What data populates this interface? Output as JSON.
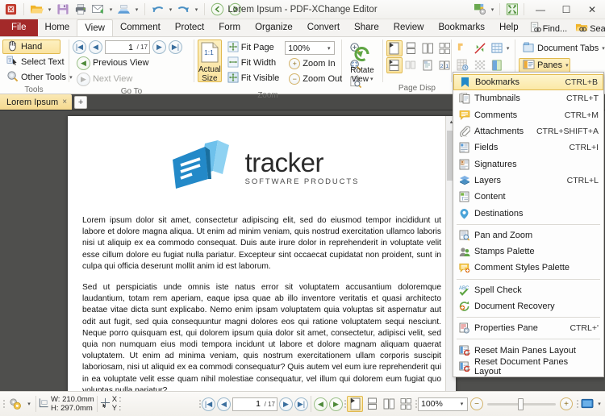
{
  "window": {
    "title": "Lorem Ipsum - PDF-XChange Editor",
    "minimize": "—",
    "maximize": "☐",
    "close": "✕"
  },
  "quick_access": {
    "items": [
      {
        "name": "app-logo-icon",
        "label": ""
      },
      {
        "name": "open-icon",
        "label": "Open"
      },
      {
        "name": "save-icon",
        "label": "Save"
      },
      {
        "name": "print-icon",
        "label": "Print"
      },
      {
        "name": "email-icon",
        "label": "Email"
      },
      {
        "name": "scan-icon",
        "label": "Scan"
      },
      {
        "name": "undo-icon",
        "label": "Undo"
      },
      {
        "name": "redo-icon",
        "label": "Redo"
      },
      {
        "name": "back-icon",
        "label": "Previous View"
      },
      {
        "name": "forward-icon",
        "label": "Next View"
      }
    ],
    "customize_icon": "customize-quick-access-icon",
    "fullscreen_icon": "fullscreen-icon"
  },
  "menubar": {
    "file": "File",
    "tabs": [
      {
        "label": "Home",
        "active": false
      },
      {
        "label": "View",
        "active": true
      },
      {
        "label": "Comment",
        "active": false
      },
      {
        "label": "Protect",
        "active": false
      },
      {
        "label": "Form",
        "active": false
      },
      {
        "label": "Organize",
        "active": false
      },
      {
        "label": "Convert",
        "active": false
      },
      {
        "label": "Share",
        "active": false
      },
      {
        "label": "Review",
        "active": false
      },
      {
        "label": "Bookmarks",
        "active": false
      },
      {
        "label": "Help",
        "active": false
      }
    ],
    "find_label": "Find...",
    "search_label": "Search...",
    "collapse_icon": "chevron-up-icon"
  },
  "ribbon": {
    "groups": [
      {
        "name": "tools",
        "label": "Tools",
        "hand_label": "Hand",
        "select_text_label": "Select Text",
        "other_tools_label": "Other Tools"
      },
      {
        "name": "goto",
        "label": "Go To",
        "page_value": "1",
        "page_total": "/ 17",
        "previous_view_label": "Previous View",
        "next_view_label": "Next View"
      },
      {
        "name": "zoom",
        "label": "Zoom",
        "actual_size_line1": "Actual",
        "actual_size_line2": "Size",
        "actual_size_glyph": "1:1",
        "fit_page_label": "Fit Page",
        "fit_width_label": "Fit Width",
        "fit_visible_label": "Fit Visible",
        "zoom_value": "100%",
        "zoom_in_label": "Zoom In",
        "zoom_out_label": "Zoom Out"
      },
      {
        "name": "rotate",
        "rotate_line1": "Rotate",
        "rotate_line2": "View"
      },
      {
        "name": "page_display",
        "label": "Page Disp"
      },
      {
        "name": "view_options",
        "label": ""
      },
      {
        "name": "panes",
        "document_tabs_label": "Document Tabs",
        "panes_label": "Panes"
      }
    ]
  },
  "doc_tabs": {
    "tabs": [
      {
        "label": "Lorem Ipsum",
        "close": "×"
      }
    ],
    "add_label": "+"
  },
  "panes_menu": {
    "items": [
      {
        "icon": "bookmark-icon",
        "label": "Bookmarks",
        "shortcut": "CTRL+B",
        "selected": true
      },
      {
        "icon": "thumbnails-icon",
        "label": "Thumbnails",
        "shortcut": "CTRL+T",
        "selected": false
      },
      {
        "icon": "comments-icon",
        "label": "Comments",
        "shortcut": "CTRL+M",
        "selected": false
      },
      {
        "icon": "attachments-icon",
        "label": "Attachments",
        "shortcut": "CTRL+SHIFT+A",
        "selected": false
      },
      {
        "icon": "fields-icon",
        "label": "Fields",
        "shortcut": "CTRL+I",
        "selected": false
      },
      {
        "icon": "signatures-icon",
        "label": "Signatures",
        "shortcut": "",
        "selected": false
      },
      {
        "icon": "layers-icon",
        "label": "Layers",
        "shortcut": "CTRL+L",
        "selected": false
      },
      {
        "icon": "content-icon",
        "label": "Content",
        "shortcut": "",
        "selected": false
      },
      {
        "icon": "destinations-icon",
        "label": "Destinations",
        "shortcut": "",
        "selected": false
      },
      {
        "separator": true
      },
      {
        "icon": "pan-and-zoom-icon",
        "label": "Pan and Zoom",
        "shortcut": "",
        "selected": false
      },
      {
        "icon": "stamps-palette-icon",
        "label": "Stamps Palette",
        "shortcut": "",
        "selected": false
      },
      {
        "icon": "comment-styles-palette-icon",
        "label": "Comment Styles Palette",
        "shortcut": "",
        "selected": false
      },
      {
        "separator": true
      },
      {
        "icon": "spell-check-icon",
        "label": "Spell Check",
        "shortcut": "",
        "selected": false
      },
      {
        "icon": "document-recovery-icon",
        "label": "Document Recovery",
        "shortcut": "",
        "selected": false
      },
      {
        "separator": true
      },
      {
        "icon": "properties-pane-icon",
        "label": "Properties Pane",
        "shortcut": "CTRL+'",
        "selected": false
      },
      {
        "separator": true
      },
      {
        "icon": "reset-main-panes-icon",
        "label": "Reset Main Panes Layout",
        "shortcut": "",
        "selected": false
      },
      {
        "icon": "reset-document-panes-icon",
        "label": "Reset Document Panes Layout",
        "shortcut": "",
        "selected": false
      }
    ]
  },
  "document": {
    "logo_main": "tracker",
    "logo_sub": "SOFTWARE PRODUCTS",
    "paragraphs": [
      "Lorem ipsum dolor sit amet, consectetur adipiscing elit, sed do eiusmod tempor incididunt ut labore et dolore magna aliqua. Ut enim ad minim veniam, quis nostrud exercitation ullamco laboris nisi ut aliquip ex ea commodo consequat. Duis aute irure dolor in reprehenderit in voluptate velit esse cillum dolore eu fugiat nulla pariatur. Excepteur sint occaecat cupidatat non proident, sunt in culpa qui officia deserunt mollit anim id est laborum.",
      "Sed ut perspiciatis unde omnis iste natus error sit voluptatem accusantium doloremque laudantium, totam rem aperiam, eaque ipsa quae ab illo inventore veritatis et quasi architecto beatae vitae dicta sunt explicabo. Nemo enim ipsam voluptatem quia voluptas sit aspernatur aut odit aut fugit, sed quia consequuntur magni dolores eos qui ratione voluptatem sequi nesciunt. Neque porro quisquam est, qui dolorem ipsum quia dolor sit amet, consectetur, adipisci velit, sed quia non numquam eius modi tempora incidunt ut labore et dolore magnam aliquam quaerat voluptatem. Ut enim ad minima veniam, quis nostrum exercitationem ullam corporis suscipit laboriosam, nisi ut aliquid ex ea commodi consequatur? Quis autem vel eum iure reprehenderit qui in ea voluptate velit esse quam nihil molestiae consequatur, vel illum qui dolorem eum fugiat quo voluptas nulla pariatur?"
    ]
  },
  "statusbar": {
    "settings_icon": "document-properties-icon",
    "page_size_w": "W: 210.0mm",
    "page_size_h": "H: 297.0mm",
    "cursor_x": "X :",
    "cursor_y": "Y :",
    "page_value": "1",
    "page_total": "/ 17",
    "zoom_value": "100%",
    "zoom_out_icon": "zoom-out-icon",
    "zoom_in_icon": "zoom-in-icon",
    "fullscreen_icon": "fullscreen-mode-icon"
  },
  "colors": {
    "accent": "#e0b94f",
    "file_tab": "#a32929",
    "doc_bg": "#4f4f4d",
    "highlight": "#fbe8a6"
  }
}
